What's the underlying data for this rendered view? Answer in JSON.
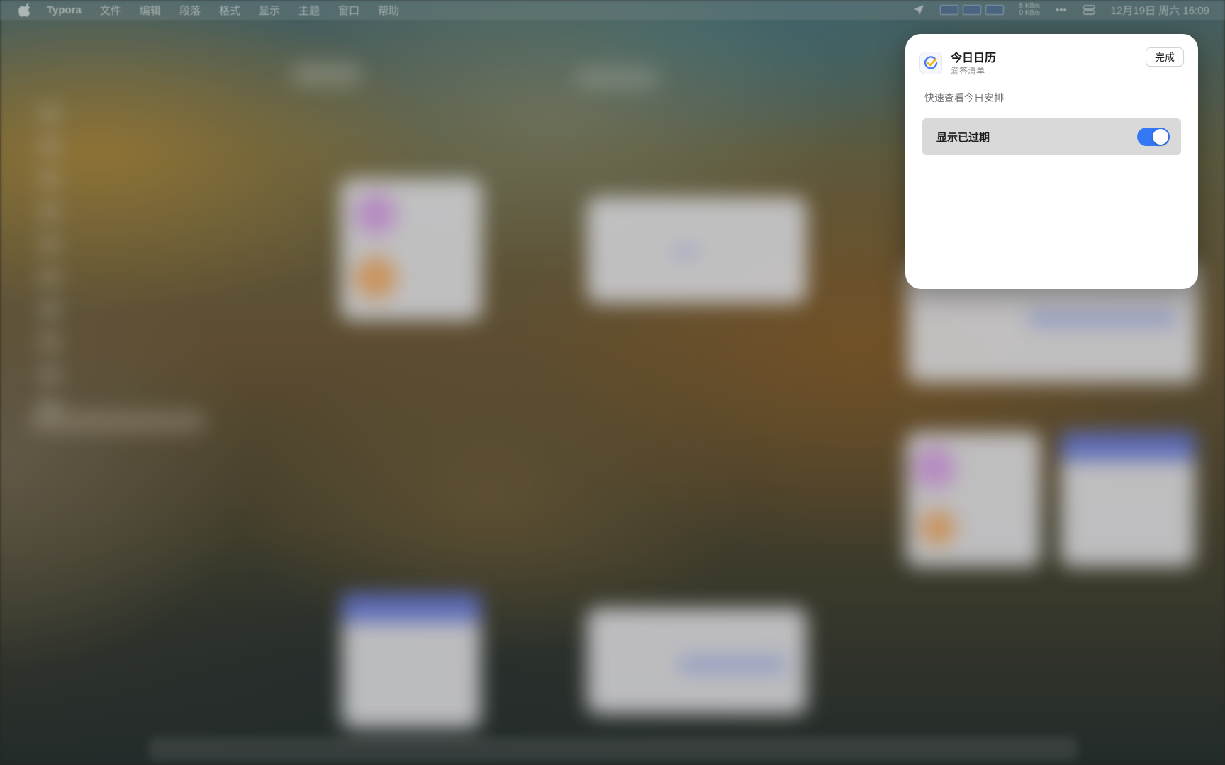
{
  "menubar": {
    "apple_icon": "apple-logo-icon",
    "app_name": "Typora",
    "menus": [
      "文件",
      "编辑",
      "段落",
      "格式",
      "显示",
      "主题",
      "窗口",
      "帮助"
    ],
    "network": {
      "upload": "5 KB/s",
      "download": "0 KB/s"
    },
    "clock": "12月19日 周六  16:09"
  },
  "panel": {
    "app_icon": "checkmark-circle-icon",
    "title": "今日日历",
    "subtitle": "滴答清单",
    "done_label": "完成",
    "description": "快速查看今日安排",
    "option": {
      "label": "显示已过期",
      "enabled": true
    }
  },
  "colors": {
    "toggle_on": "#3478f6",
    "option_row_bg": "#d9d9d9",
    "panel_bg": "#ffffff"
  }
}
